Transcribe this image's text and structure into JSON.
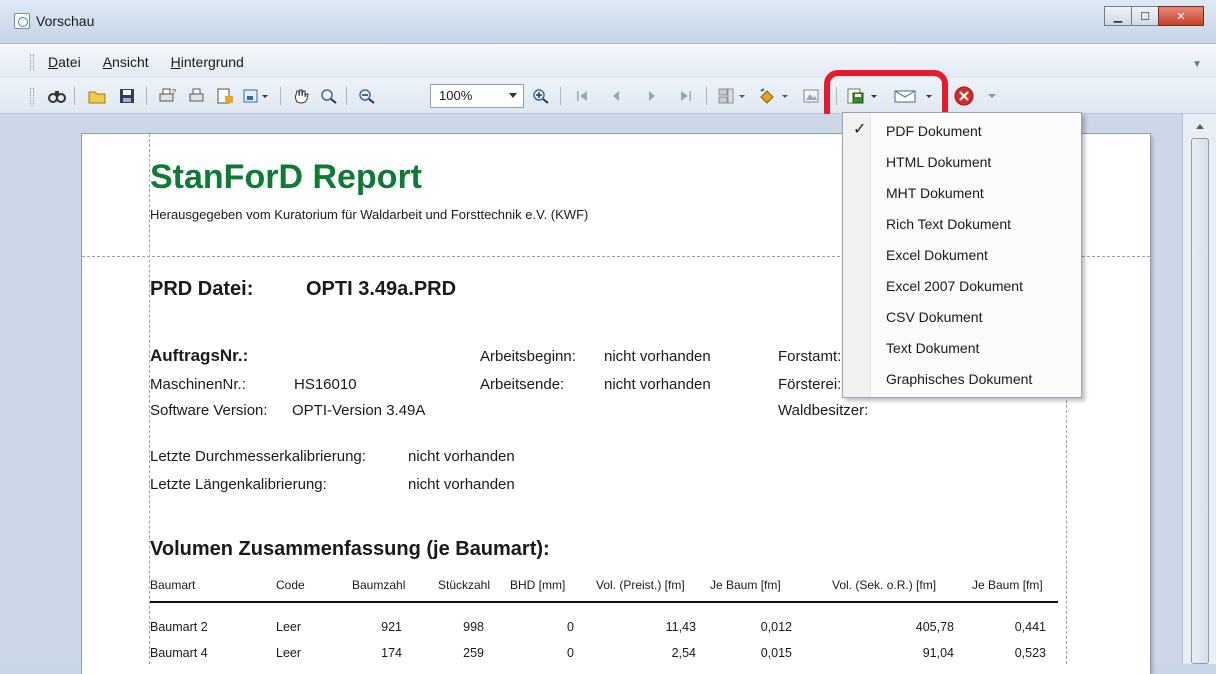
{
  "window": {
    "title": "Vorschau"
  },
  "menu": [
    "Datei",
    "Ansicht",
    "Hintergrund"
  ],
  "toolbar": {
    "zoom": "100%"
  },
  "export_menu": {
    "items": [
      "PDF Dokument",
      "HTML Dokument",
      "MHT Dokument",
      "Rich Text Dokument",
      "Excel Dokument",
      "Excel 2007 Dokument",
      "CSV Dokument",
      "Text Dokument",
      "Graphisches Dokument"
    ],
    "checked": "PDF Dokument"
  },
  "report": {
    "title": "StanForD Report",
    "subtitle": "Herausgegeben vom Kuratorium für Waldarbeit und Forsttechnik e.V. (KWF)",
    "prd_label": "PRD Datei:",
    "prd_value": "OPTI 3.49a.PRD",
    "auftrag_label": "AuftragsNr.:",
    "maschine_label": "MaschinenNr.:",
    "maschine_value": "HS16010",
    "software_label": "Software Version:",
    "software_value": "OPTI-Version 3.49A",
    "beginn_label": "Arbeitsbeginn:",
    "beginn_value": "nicht vorhanden",
    "ende_label": "Arbeitsende:",
    "ende_value": "nicht vorhanden",
    "forstamt_label": "Forstamt:",
    "foersterei_label": "Försterei:",
    "waldbesitzer_label": "Waldbesitzer:",
    "durchmesser_label": "Letzte Durchmesserkalibrierung:",
    "durchmesser_value": "nicht vorhanden",
    "laengen_label": "Letzte Längenkalibrierung:",
    "laengen_value": "nicht vorhanden",
    "volumen_title": "Volumen Zusammenfassung (je Baumart):",
    "table": {
      "headers": [
        "Baumart",
        "Code",
        "Baumzahl",
        "Stückzahl",
        "BHD [mm]",
        "Vol. (Preist.) [fm]",
        "Je Baum [fm]",
        "Vol. (Sek. o.R.) [fm]",
        "Je Baum [fm]"
      ],
      "rows": [
        [
          "Baumart 2",
          "Leer",
          "921",
          "998",
          "0",
          "11,43",
          "0,012",
          "405,78",
          "0,441"
        ],
        [
          "Baumart 4",
          "Leer",
          "174",
          "259",
          "0",
          "2,54",
          "0,015",
          "91,04",
          "0,523"
        ]
      ]
    }
  }
}
